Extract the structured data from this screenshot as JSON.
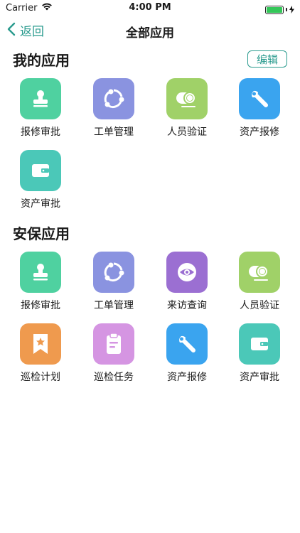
{
  "statusbar": {
    "carrier": "Carrier",
    "time": "4:00 PM"
  },
  "navbar": {
    "back_label": "返回",
    "title": "全部应用"
  },
  "colors": {
    "accent": "#2a9b8e"
  },
  "my_apps": {
    "title": "我的应用",
    "edit_label": "编辑",
    "items": [
      {
        "label": "报修审批",
        "icon": "stamp-icon",
        "color": "#4fd1a0"
      },
      {
        "label": "工单管理",
        "icon": "cycle-icon",
        "color": "#8a93e0"
      },
      {
        "label": "人员验证",
        "icon": "id-card-icon",
        "color": "#a0d168"
      },
      {
        "label": "资产报修",
        "icon": "wrench-icon",
        "color": "#3aa4ef"
      },
      {
        "label": "资产审批",
        "icon": "wallet-icon",
        "color": "#4bc8b8"
      }
    ]
  },
  "security_apps": {
    "title": "安保应用",
    "items": [
      {
        "label": "报修审批",
        "icon": "stamp-icon",
        "color": "#4fd1a0"
      },
      {
        "label": "工单管理",
        "icon": "cycle-icon",
        "color": "#8a93e0"
      },
      {
        "label": "来访查询",
        "icon": "eye-icon",
        "color": "#9b6fd2"
      },
      {
        "label": "人员验证",
        "icon": "id-card-icon",
        "color": "#a0d168"
      },
      {
        "label": "巡检计划",
        "icon": "bookmark-star-icon",
        "color": "#ef9a4e"
      },
      {
        "label": "巡检任务",
        "icon": "clipboard-icon",
        "color": "#d595e2"
      },
      {
        "label": "资产报修",
        "icon": "wrench-icon",
        "color": "#3aa4ef"
      },
      {
        "label": "资产审批",
        "icon": "wallet-icon",
        "color": "#4bc8b8"
      }
    ]
  }
}
